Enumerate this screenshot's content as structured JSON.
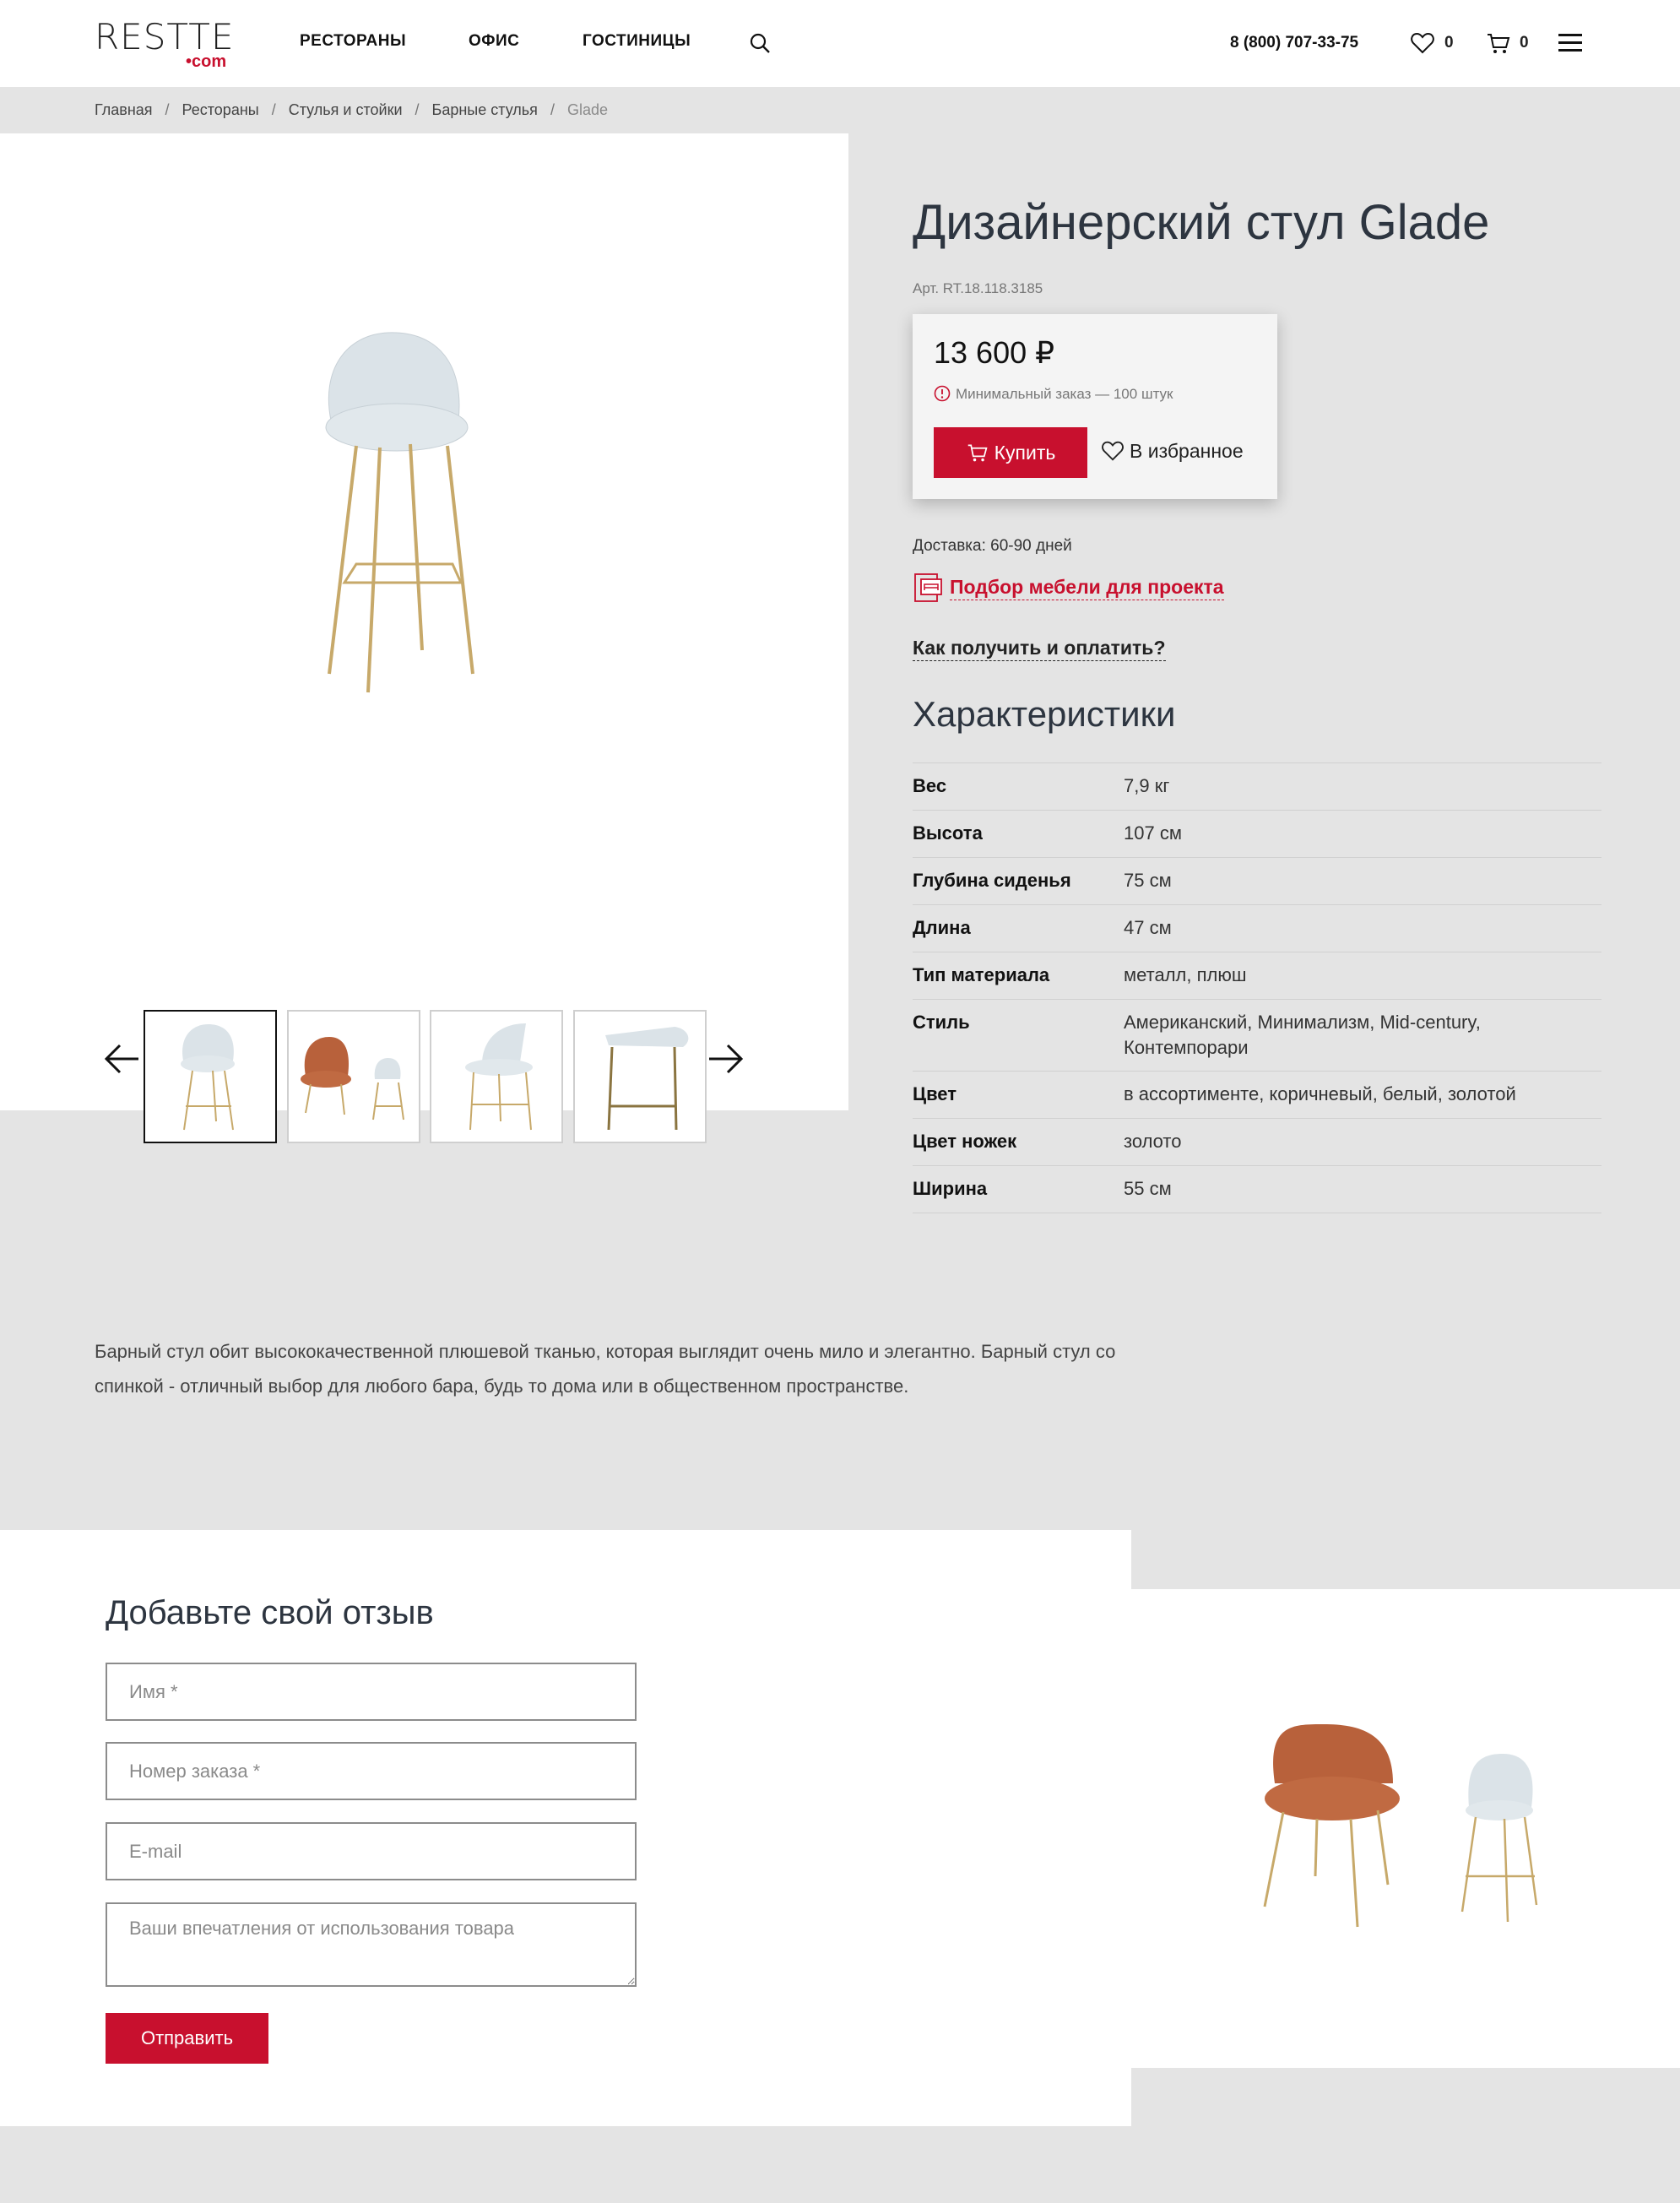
{
  "header": {
    "logo_main": "RESTTE",
    "logo_sub": "•com",
    "nav": [
      "РЕСТОРАНЫ",
      "ОФИС",
      "ГОСТИНИЦЫ"
    ],
    "phone": "8 (800) 707-33-75",
    "favorites_count": "0",
    "cart_count": "0"
  },
  "breadcrumb": [
    "Главная",
    "Рестораны",
    "Стулья и стойки",
    "Барные стулья",
    "Glade"
  ],
  "product": {
    "title": "Дизайнерский стул Glade",
    "sku": "Арт. RT.18.118.3185",
    "price": "13 600 ₽",
    "min_order": "Минимальный заказ — 100 штук",
    "buy_label": "Купить",
    "favorite_label": "В избранное",
    "delivery": "Доставка: 60-90 дней",
    "project_link": "Подбор мебели для проекта",
    "howto_link": "Как получить и оплатить?",
    "colors": {
      "accent": "#c8102e",
      "chair_light": "#dde5ea",
      "chair_rust": "#b8613b",
      "legs_gold": "#c7a96a"
    }
  },
  "specs": {
    "title": "Характеристики",
    "rows": [
      {
        "key": "Вес",
        "value": "7,9 кг"
      },
      {
        "key": "Высота",
        "value": "107 см"
      },
      {
        "key": "Глубина сиденья",
        "value": "75 см"
      },
      {
        "key": "Длина",
        "value": "47 см"
      },
      {
        "key": "Тип материала",
        "value": "металл, плюш"
      },
      {
        "key": "Стиль",
        "value": "Американский, Минимализм, Mid-century, Контемпорари"
      },
      {
        "key": "Цвет",
        "value": "в ассортименте, коричневый, белый, золотой"
      },
      {
        "key": "Цвет ножек",
        "value": "золото"
      },
      {
        "key": "Ширина",
        "value": "55 см"
      }
    ]
  },
  "description": "Барный стул обит высококачественной плюшевой тканью, которая выглядит очень мило и элегантно. Барный стул со спинкой - отличный выбор для любого бара, будь то дома или в общественном пространстве.",
  "review": {
    "title": "Добавьте свой отзыв",
    "name_placeholder": "Имя *",
    "order_placeholder": "Номер заказа *",
    "email_placeholder": "E-mail",
    "comment_placeholder": "Ваши впечатления от использования товара",
    "submit_label": "Отправить"
  },
  "icons": [
    "search-icon",
    "heart-icon",
    "cart-icon",
    "menu-icon",
    "info-icon",
    "catalog-icon",
    "arrow-left-icon",
    "arrow-right-icon"
  ]
}
